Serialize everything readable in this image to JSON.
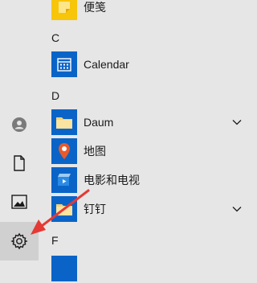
{
  "rail": {
    "items": [
      {
        "icon": "user-icon"
      },
      {
        "icon": "document-icon"
      },
      {
        "icon": "pictures-icon"
      },
      {
        "icon": "settings-gear-icon"
      }
    ]
  },
  "apps": {
    "groups": [
      {
        "letter": "C"
      },
      {
        "letter": "D"
      },
      {
        "letter": "F"
      }
    ],
    "items": [
      {
        "label": "便笺",
        "icon": "sticky-notes-icon",
        "has_chevron": false
      },
      {
        "label": "Calendar",
        "icon": "calendar-icon",
        "has_chevron": false
      },
      {
        "label": "Daum",
        "icon": "folder-icon",
        "has_chevron": true
      },
      {
        "label": "地图",
        "icon": "maps-pin-icon",
        "has_chevron": false
      },
      {
        "label": "电影和电视",
        "icon": "movies-tv-icon",
        "has_chevron": false
      },
      {
        "label": "钉钉",
        "icon": "folder-icon",
        "has_chevron": true
      },
      {
        "label": "",
        "icon": "partial-app-icon",
        "has_chevron": false
      }
    ]
  },
  "annotation": {
    "arrow_color": "#e53935"
  }
}
